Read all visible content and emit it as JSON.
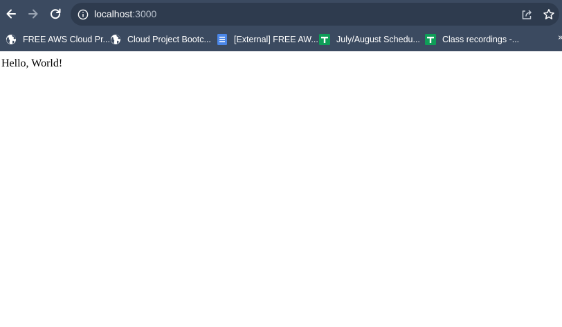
{
  "browser": {
    "url_host": "localhost",
    "url_port": ":3000",
    "icons": {
      "back": "back-arrow-icon",
      "forward": "forward-arrow-icon",
      "reload": "reload-icon",
      "site_info": "info-icon",
      "share": "share-icon",
      "bookmark_star": "star-icon"
    },
    "colors": {
      "chrome_background": "#3b4a60",
      "omnibox_background": "#2e3b4e"
    }
  },
  "bookmarks": [
    {
      "label": "FREE AWS Cloud Pr...",
      "icon": "globe-icon"
    },
    {
      "label": "Cloud Project Bootc...",
      "icon": "globe-icon"
    },
    {
      "label": "[External] FREE AW...",
      "icon": "google-docs-icon"
    },
    {
      "label": "July/August Schedu...",
      "icon": "google-sheets-icon"
    },
    {
      "label": "Class recordings -...",
      "icon": "google-sheets-icon"
    }
  ],
  "page": {
    "text": "Hello, World!"
  }
}
